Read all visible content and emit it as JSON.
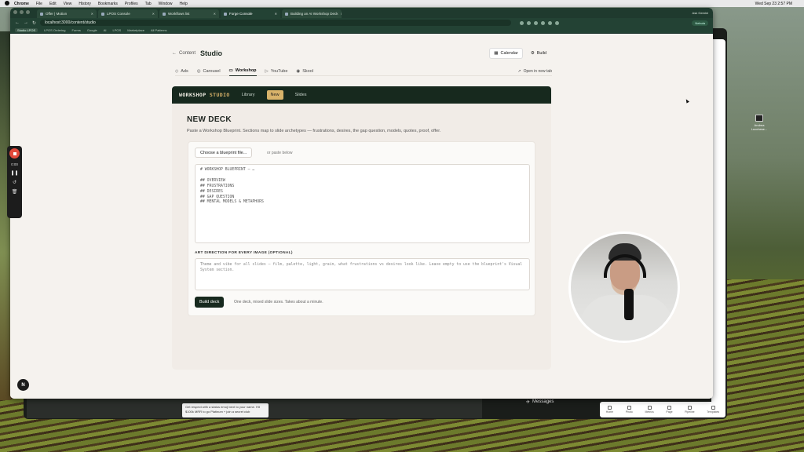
{
  "menubar": {
    "app": "Chrome",
    "items": [
      "File",
      "Edit",
      "View",
      "History",
      "Bookmarks",
      "Profiles",
      "Tab",
      "Window",
      "Help"
    ],
    "clock": "Wed Sep 23  2:57 PM"
  },
  "browser": {
    "tabs": [
      {
        "label": "Offer | Motion"
      },
      {
        "label": "LPOS Console"
      },
      {
        "label": "Workflows list"
      },
      {
        "label": "Forge Console"
      },
      {
        "label": "Building an AI Workshop Deck"
      }
    ],
    "ask_label": "Ask Gemini",
    "url": "localhost:3000/content/studio",
    "profile_chip": "Nebula",
    "bookmarks": [
      "Studio LPOS",
      "LPOS Ordering",
      "Forms",
      "Google",
      "AI",
      "LPOS",
      "Marketplace",
      "All Patterns"
    ]
  },
  "page": {
    "back_label": "Content",
    "title": "Studio",
    "calendar_label": "Calendar",
    "build_label": "Build",
    "subnav": [
      "Ads",
      "Carousel",
      "Workshop",
      "YouTube",
      "Skool"
    ],
    "active_subnav": "Workshop",
    "open_new_tab": "Open in new tab"
  },
  "studio": {
    "brand_a": "WORKSHOP",
    "brand_b": "STUDIO",
    "tabs": [
      "Library",
      "New",
      "Slides"
    ],
    "active_tab": "New"
  },
  "deck": {
    "heading": "NEW DECK",
    "description": "Paste a Workshop Blueprint. Sections map to slide archetypes — frustrations, desires, the gap question, models, quotes, proof, offer.",
    "file_button": "Choose a blueprint file...",
    "or_paste": "or paste below",
    "blueprint_text": "# WORKSHOP BLUEPRINT — …\n\n## OVERVIEW\n## FRUSTRATIONS\n## DESIRES\n## GAP QUESTION\n## MENTAL MODELS & METAPHORS",
    "art_label": "ART DIRECTION FOR EVERY IMAGE (OPTIONAL)",
    "art_placeholder": "Theme and vibe for all slides — film, palette, light, grain, what frustrations vs desires look like. Leave empty to use the blueprint's Visual System section.",
    "build_button": "Build deck",
    "build_hint": "One deck, mixed slide sizes. Takes about a minute."
  },
  "recorder": {
    "time": "0:00"
  },
  "overlay": {
    "n_badge": "N",
    "messages": "Messages",
    "tooltip": "Get respect with a status emoji next to your name. Hit $100k MRR to go Platinum + join a secret club"
  },
  "dock": [
    "Home",
    "Photo",
    "Metrics",
    "Page",
    "Pipeline",
    "Templates"
  ],
  "desktop_icon": "Andrea Lucchese..."
}
